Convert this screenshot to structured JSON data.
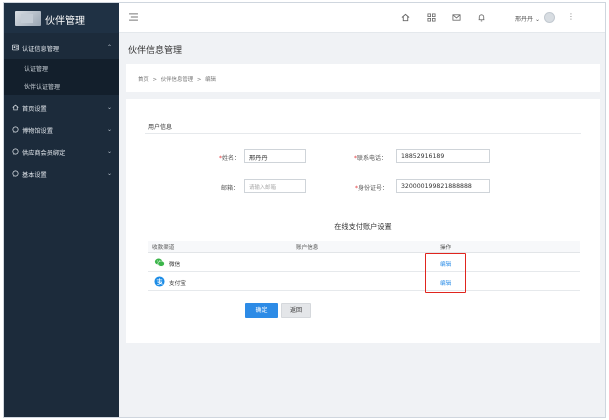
{
  "app": {
    "title": "伙伴管理"
  },
  "sidebar": {
    "items": [
      {
        "label": "认证信息管理",
        "icon": "user-card-icon",
        "expanded": true,
        "children": [
          {
            "label": "认证管理"
          },
          {
            "label": "伙伴认证管理"
          }
        ]
      },
      {
        "label": "首页设置",
        "icon": "home-icon"
      },
      {
        "label": "博物馆设置",
        "icon": "chat-icon"
      },
      {
        "label": "供应商会员绑定",
        "icon": "chat-icon"
      },
      {
        "label": "基本设置",
        "icon": "chat-icon"
      }
    ]
  },
  "topbar": {
    "menu_icon": "menu-icon",
    "icons": [
      "home-icon",
      "grid-icon",
      "mail-icon",
      "bell-icon"
    ],
    "username": "邢丹丹"
  },
  "page": {
    "title": "伙伴信息管理",
    "breadcrumb": [
      "首页",
      ">",
      "伙伴信息管理",
      ">",
      "编辑"
    ]
  },
  "user_info": {
    "section_title": "用户信息",
    "name_label": "姓名：",
    "name_value": "邢丹丹",
    "phone_label": "联系电话：",
    "phone_value": "18852916189",
    "email_label": "邮箱：",
    "email_placeholder": "请输入邮箱",
    "idcard_label": "身份证号：",
    "idcard_value": "320000199821888888",
    "required_mark": "*"
  },
  "payment": {
    "title": "在线支付账户设置",
    "columns": [
      "收款渠道",
      "账户信息",
      "操作"
    ],
    "rows": [
      {
        "channel": "微信",
        "account": "",
        "action": "编辑",
        "icon": "wechat-icon",
        "color": "#3bb54a"
      },
      {
        "channel": "支付宝",
        "account": "",
        "action": "编辑",
        "icon": "alipay-icon",
        "color": "#1c8ce6"
      }
    ]
  },
  "actions": {
    "confirm": "确定",
    "back": "返回"
  },
  "colors": {
    "sidebar": "#1c2b3b",
    "primary": "#2d8be6",
    "link": "#2f8fe8",
    "highlight": "#e0251e"
  }
}
